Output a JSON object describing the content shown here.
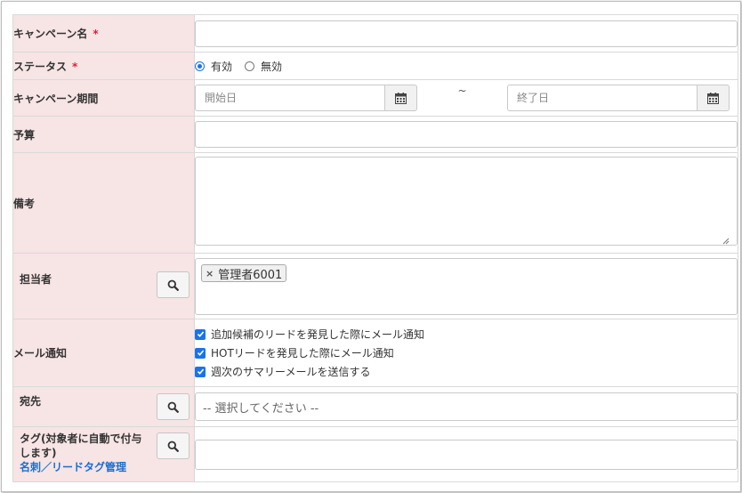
{
  "fields": {
    "campaign_name": {
      "label": "キャンペーン名",
      "required_mark": "*",
      "value": "",
      "placeholder": ""
    },
    "status": {
      "label": "ステータス",
      "required_mark": "*",
      "options": [
        {
          "label": "有効",
          "selected": true
        },
        {
          "label": "無効",
          "selected": false
        }
      ]
    },
    "period": {
      "label": "キャンペーン期間",
      "start_placeholder": "開始日",
      "separator": "~",
      "end_placeholder": "終了日",
      "icon": "calendar-icon"
    },
    "budget": {
      "label": "予算",
      "value": ""
    },
    "notes": {
      "label": "備考",
      "value": ""
    },
    "owner": {
      "label": "担当者",
      "search_icon": "search-icon",
      "tags": [
        {
          "remove": "×",
          "text": "管理者6001"
        }
      ]
    },
    "mail_notify": {
      "label": "メール通知",
      "options": [
        {
          "label": "追加候補のリードを発見した際にメール通知",
          "checked": true
        },
        {
          "label": "HOTリードを発見した際にメール通知",
          "checked": true
        },
        {
          "label": "週次のサマリーメールを送信する",
          "checked": true
        }
      ]
    },
    "recipient": {
      "label": "宛先",
      "search_icon": "search-icon",
      "select_value": "-- 選択してください --"
    },
    "tag": {
      "label": "タグ(対象者に自動で付与します)",
      "search_icon": "search-icon",
      "link": "名刺／リードタグ管理",
      "value": ""
    }
  },
  "colors": {
    "label_bg": "#f7e4e4",
    "required": "#e0203a",
    "accent": "#1a73e8",
    "link": "#1a6fd0"
  }
}
